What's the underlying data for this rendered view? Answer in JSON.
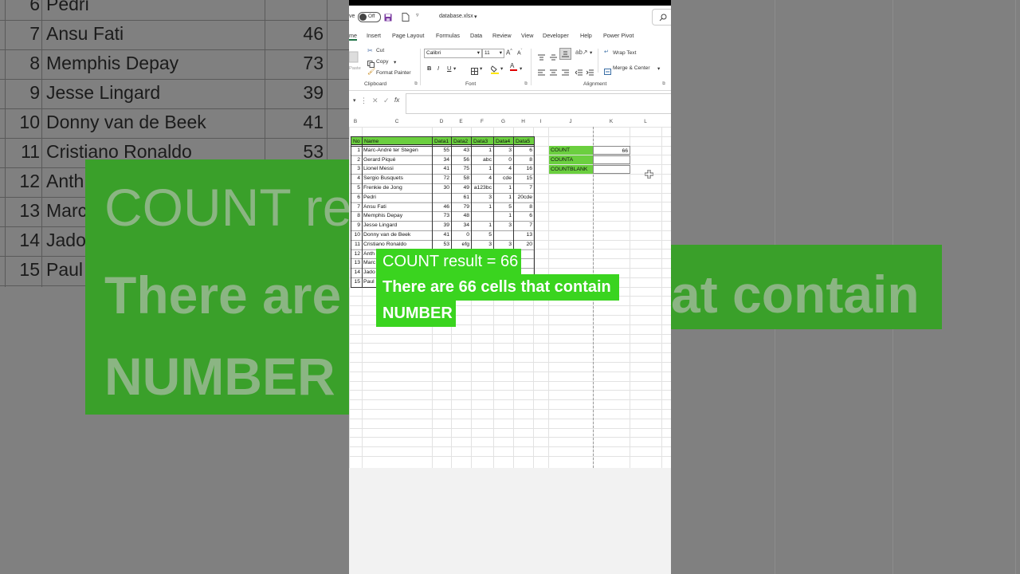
{
  "background": {
    "rows": [
      {
        "num": "6",
        "name": "Pedri",
        "val": ""
      },
      {
        "num": "7",
        "name": "Ansu Fati",
        "val": "46"
      },
      {
        "num": "8",
        "name": "Memphis Depay",
        "val": "73"
      },
      {
        "num": "9",
        "name": "Jesse Lingard",
        "val": "39"
      },
      {
        "num": "10",
        "name": "Donny van de Beek",
        "val": "41"
      },
      {
        "num": "11",
        "name": "Cristiano Ronaldo",
        "val": "53"
      },
      {
        "num": "12",
        "name": "Anth",
        "val": ""
      },
      {
        "num": "13",
        "name": "Marc",
        "val": ""
      },
      {
        "num": "14",
        "name": "Jado",
        "val": ""
      },
      {
        "num": "15",
        "name": "Paul",
        "val": ""
      }
    ],
    "big_line1": "COUNT re",
    "big_line2_left": "There are",
    "big_line2_right": "at contain",
    "big_line3": "NUMBER"
  },
  "titlebar": {
    "autosave": "ve",
    "toggle": "Off",
    "filename": "database.xlsx",
    "filename_chevron": "▾"
  },
  "menu": [
    "me",
    "Insert",
    "Page Layout",
    "Formulas",
    "Data",
    "Review",
    "View",
    "Developer",
    "Help",
    "Power Pivot"
  ],
  "ribbon": {
    "paste": "Paste",
    "cut": "Cut",
    "copy": "Copy",
    "format_painter": "Format Painter",
    "clipboard_label": "Clipboard",
    "font_name": "Calibri",
    "font_size": "11",
    "bold": "B",
    "italic": "I",
    "underline": "U",
    "font_label": "Font",
    "wrap_text": "Wrap Text",
    "merge_center": "Merge & Center",
    "alignment_label": "Alignment"
  },
  "formula_bar": {
    "fx": "fx",
    "value": ""
  },
  "columns": [
    "B",
    "C",
    "D",
    "E",
    "F",
    "G",
    "H",
    "I",
    "J",
    "K",
    "L"
  ],
  "table": {
    "headers": [
      "No",
      "Name",
      "Data1",
      "Data2",
      "Data3",
      "Data4",
      "Data5"
    ],
    "rows": [
      [
        "1",
        "Marc-André ter Stegen",
        "55",
        "43",
        "1",
        "3",
        "6"
      ],
      [
        "2",
        "Gerard Piqué",
        "34",
        "56",
        "abc",
        "0",
        "8"
      ],
      [
        "3",
        "Lionel Messi",
        "41",
        "75",
        "1",
        "4",
        "16"
      ],
      [
        "4",
        "Sergio Busquets",
        "72",
        "58",
        "4",
        "cde",
        "15"
      ],
      [
        "5",
        "Frenkie de Jong",
        "30",
        "49",
        "a123bc",
        "1",
        "7"
      ],
      [
        "6",
        "Pedri",
        "",
        "61",
        "3",
        "1",
        "20cde"
      ],
      [
        "7",
        "Ansu Fati",
        "46",
        "79",
        "1",
        "5",
        "8"
      ],
      [
        "8",
        "Memphis Depay",
        "73",
        "48",
        "",
        "1",
        "6"
      ],
      [
        "9",
        "Jesse Lingard",
        "39",
        "34",
        "1",
        "3",
        "7"
      ],
      [
        "10",
        "Donny van de Beek",
        "41",
        "0",
        "5",
        "",
        "13"
      ],
      [
        "11",
        "Cristiano Ronaldo",
        "53",
        "efg",
        "3",
        "3",
        "20"
      ],
      [
        "12",
        "Anth",
        "",
        "",
        "",
        "",
        ""
      ],
      [
        "13",
        "Marc",
        "",
        "",
        "",
        "",
        ""
      ],
      [
        "14",
        "Jado",
        "",
        "",
        "",
        "",
        ""
      ],
      [
        "15",
        "Paul",
        "",
        "",
        "",
        "",
        ""
      ]
    ]
  },
  "stats": [
    {
      "label": "COUNT",
      "value": "66"
    },
    {
      "label": "COUNTA",
      "value": ""
    },
    {
      "label": "COUNTBLANK",
      "value": ""
    }
  ],
  "captions": {
    "line1": "COUNT result = 66",
    "line2": "There are 66 cells that contain",
    "line3": "NUMBER"
  },
  "colors": {
    "caption_bg": "#3ad41f",
    "header_green": "#6bcf3f"
  }
}
